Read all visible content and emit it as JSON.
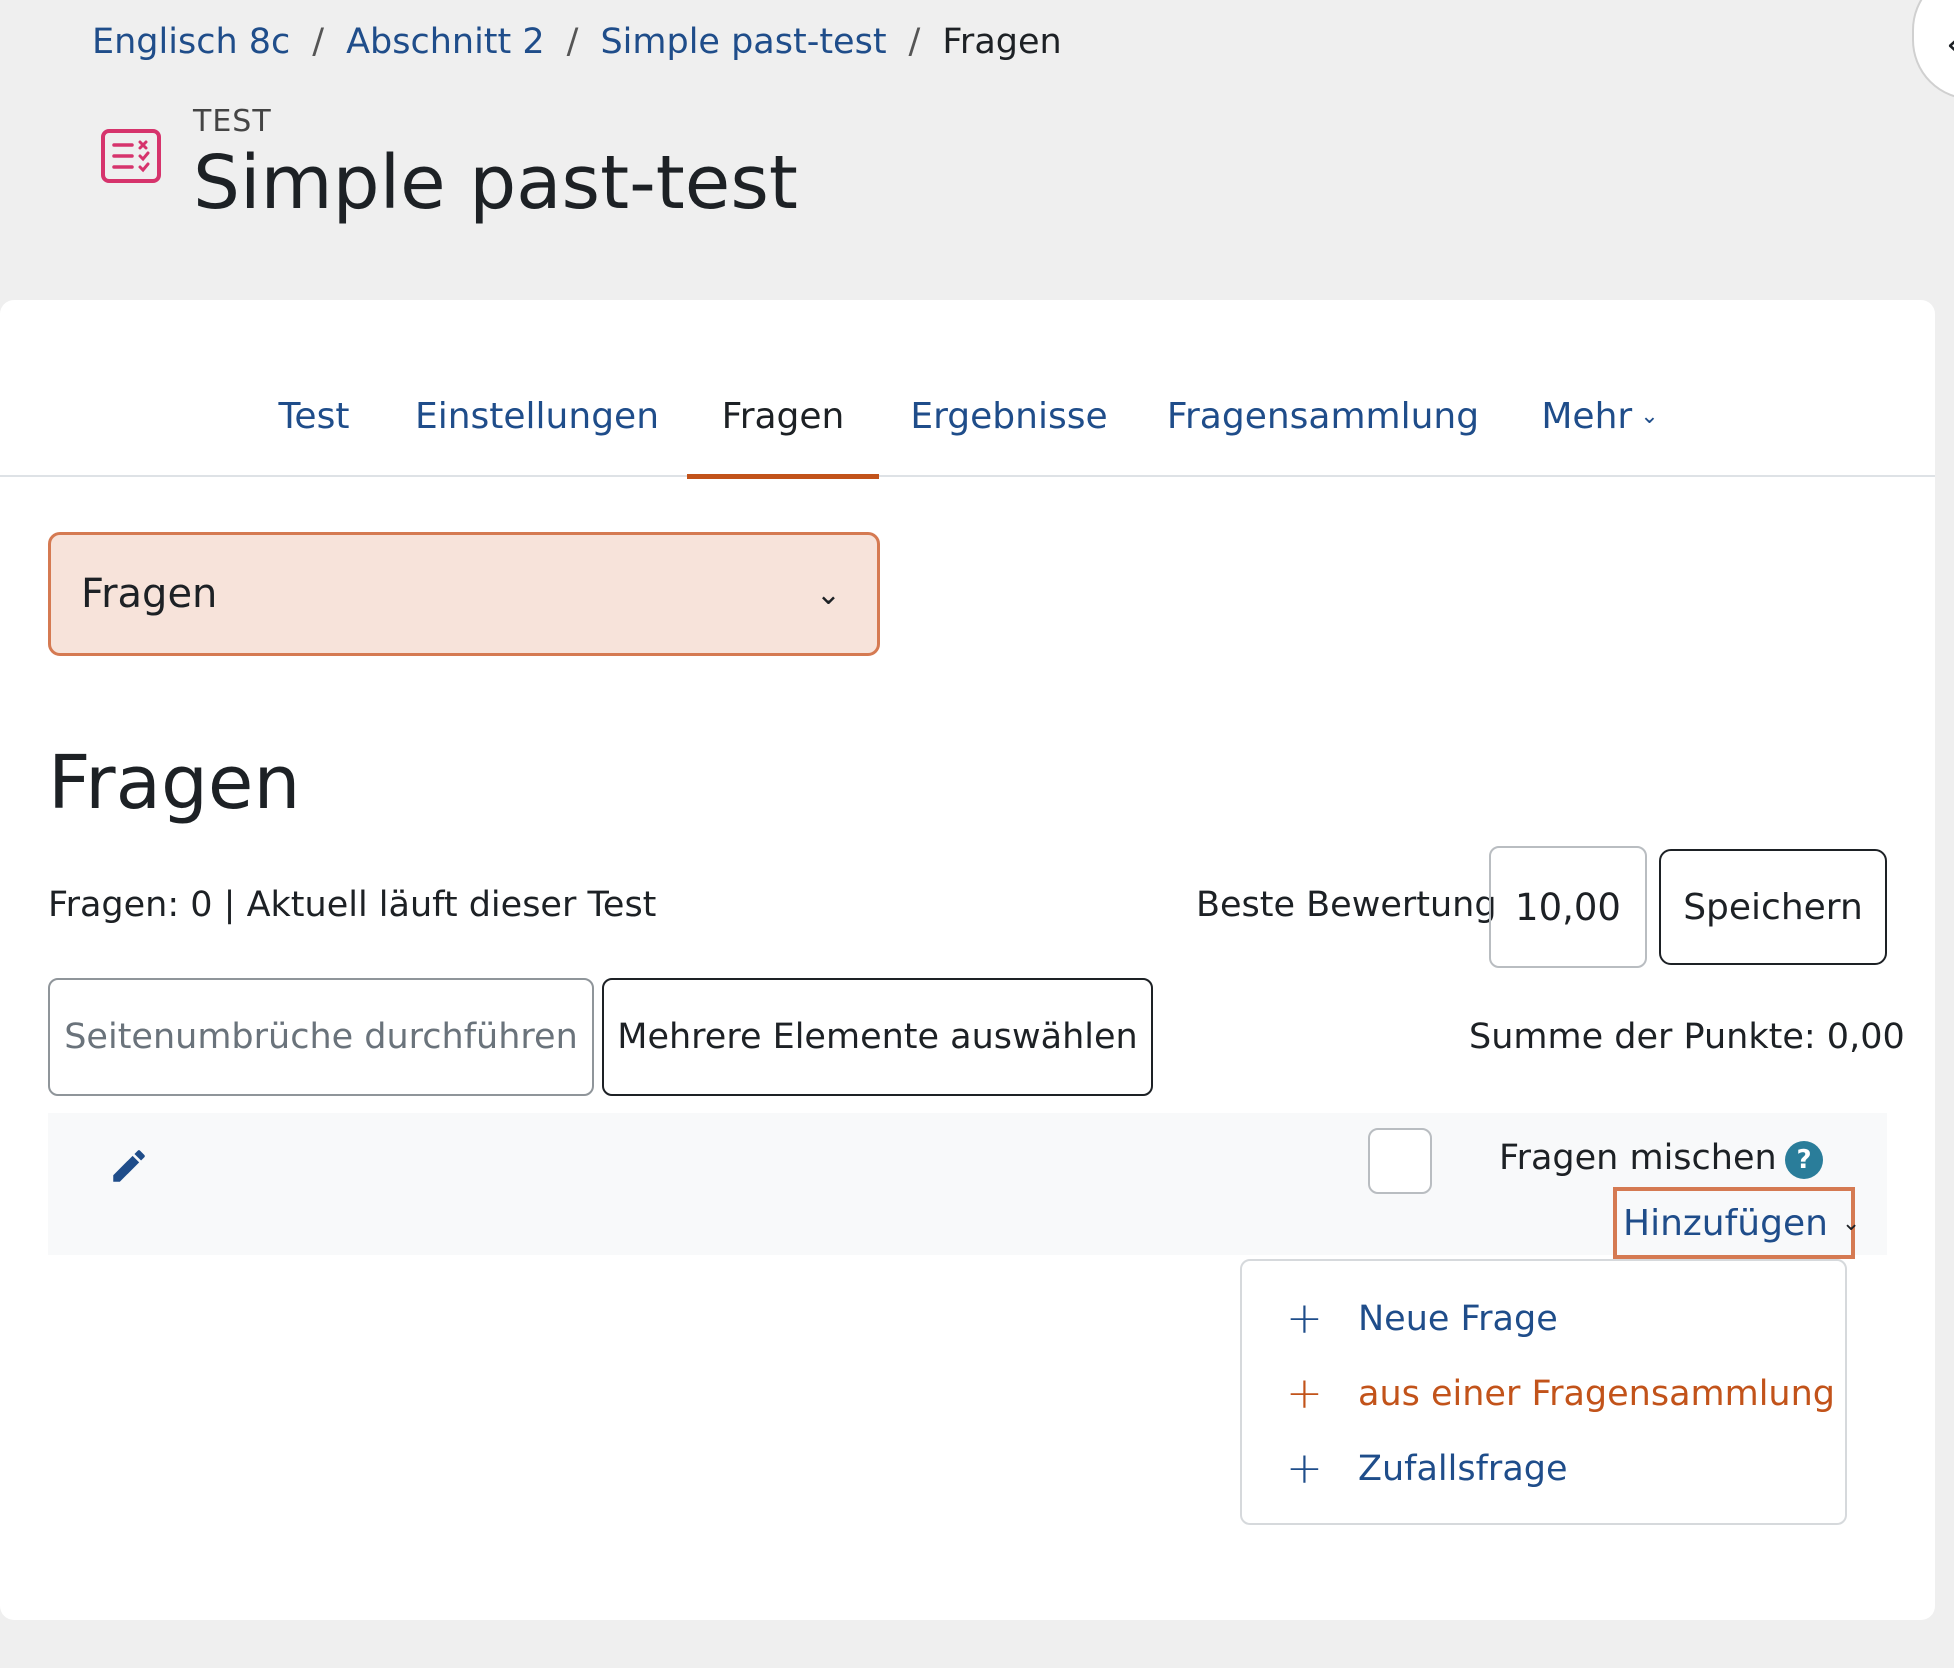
{
  "breadcrumb": {
    "items": [
      "Englisch 8c",
      "Abschnitt 2",
      "Simple past-test"
    ],
    "current": "Fragen",
    "separator": "/"
  },
  "header": {
    "module_type": "TEST",
    "title": "Simple past-test",
    "icon": "quiz-icon"
  },
  "tabs": [
    {
      "label": "Test"
    },
    {
      "label": "Einstellungen"
    },
    {
      "label": "Fragen",
      "active": true
    },
    {
      "label": "Ergebnisse"
    },
    {
      "label": "Fragensammlung"
    },
    {
      "label": "Mehr"
    }
  ],
  "page_select": {
    "value": "Fragen"
  },
  "section_title": "Fragen",
  "info": {
    "text": "Fragen: 0 | Aktuell läuft dieser Test"
  },
  "grade": {
    "label": "Beste Bewertung",
    "value": "10,00",
    "save_label": "Speichern"
  },
  "actions": {
    "repaginate": "Seitenumbrüche durchführen",
    "select_multiple": "Mehrere Elemente auswählen"
  },
  "sum": {
    "text": "Summe der Punkte: 0,00"
  },
  "section": {
    "shuffle_label": "Fragen mischen",
    "help": "?",
    "add_label": "Hinzufügen"
  },
  "add_dropdown": {
    "items": [
      {
        "plus": "+",
        "label": "Neue Frage"
      },
      {
        "plus": "+",
        "label": "aus einer Fragensammlung"
      },
      {
        "plus": "+",
        "label": "Zufallsfrage"
      }
    ]
  },
  "colors": {
    "link": "#1f4d8a",
    "accent": "#c2531a",
    "highlight_border": "#d57a52",
    "select_bg": "#f7e3da",
    "quiz_icon": "#d6336c"
  }
}
